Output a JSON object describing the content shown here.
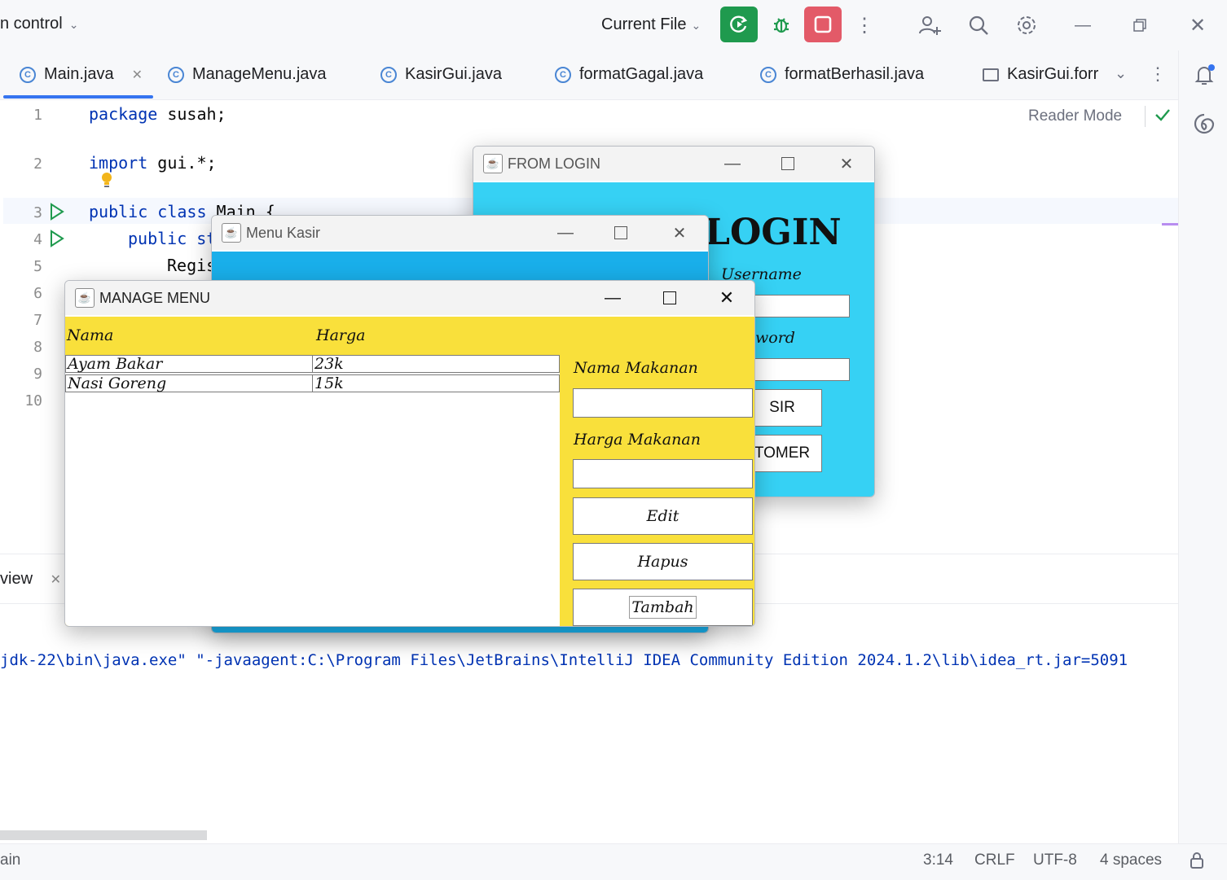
{
  "ide": {
    "project_widget": "n control",
    "run_config": "Current File",
    "tabs": [
      {
        "label": "Main.java"
      },
      {
        "label": "ManageMenu.java"
      },
      {
        "label": "KasirGui.java"
      },
      {
        "label": "formatGagal.java"
      },
      {
        "label": "formatBerhasil.java"
      },
      {
        "label": "KasirGui.forr"
      }
    ],
    "reader_mode": "Reader Mode",
    "editor": {
      "line_numbers": [
        "1",
        "2",
        "3",
        "4",
        "5",
        "6",
        "7",
        "8",
        "9",
        "10"
      ],
      "lines": {
        "l1_kw": "package",
        "l1_rest": " susah;",
        "l2_kw": "import",
        "l2_rest": " gui.*;",
        "l3_kw": "public class",
        "l3_rest": " Main {",
        "l4_kw": "public st",
        "l5": "Regis"
      }
    },
    "run_tab": "view",
    "console_line": "jdk-22\\bin\\java.exe\" \"-javaagent:C:\\Program Files\\JetBrains\\IntelliJ IDEA Community Edition 2024.1.2\\lib\\idea_rt.jar=5091",
    "status": {
      "branch": "ain",
      "position": "3:14",
      "line_sep": "CRLF",
      "encoding": "UTF-8",
      "indent": "4 spaces"
    }
  },
  "login_window": {
    "title": "FROM LOGIN",
    "heading": "LOGIN",
    "username_label": "Username",
    "password_label": "word",
    "btn_kasir": "SIR",
    "btn_customer": "TOMER"
  },
  "kasir_window": {
    "title": "Menu Kasir"
  },
  "manage_window": {
    "title": "MANAGE MENU",
    "columns": [
      "Nama",
      "Harga"
    ],
    "rows": [
      {
        "nama": "Ayam Bakar",
        "harga": "23k"
      },
      {
        "nama": "Nasi Goreng",
        "harga": "15k"
      }
    ],
    "nama_label": "Nama Makanan",
    "harga_label": "Harga Makanan",
    "btn_edit": "Edit",
    "btn_hapus": "Hapus",
    "btn_tambah": "Tambah"
  },
  "colors": {
    "accent": "#3574f0",
    "run_green": "#1f9a4e",
    "stop_red": "#e35a68",
    "login_bg": "#36d1f4",
    "kasir_bg": "#19afea",
    "manage_bg": "#f9e03b"
  },
  "icons": [
    "chevron-down-icon",
    "run-icon",
    "debug-icon",
    "stop-icon",
    "more-icon",
    "add-user-icon",
    "search-icon",
    "gear-icon",
    "minimize-icon",
    "restore-icon",
    "close-icon",
    "class-icon",
    "notification-icon",
    "ai-assistant-icon",
    "java-icon",
    "lock-icon",
    "bulb-icon",
    "run-gutter-icon",
    "check-icon"
  ]
}
